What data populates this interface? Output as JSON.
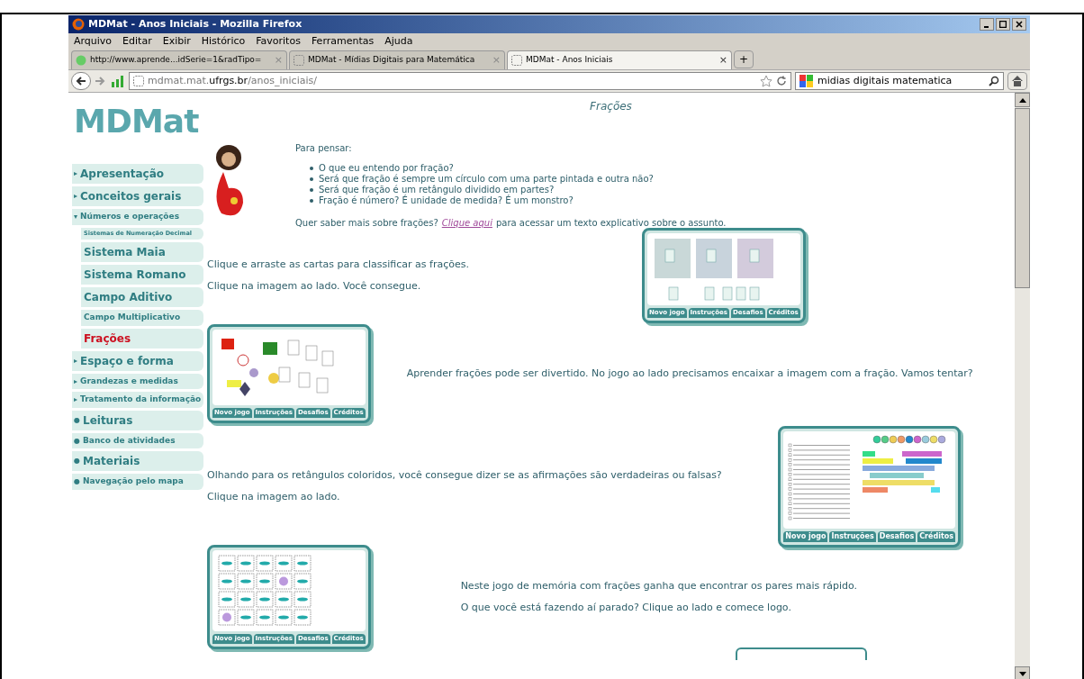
{
  "window": {
    "title": "MDMat - Anos Iniciais - Mozilla Firefox"
  },
  "menu": [
    "Arquivo",
    "Editar",
    "Exibir",
    "Histórico",
    "Favoritos",
    "Ferramentas",
    "Ajuda"
  ],
  "tabs": [
    {
      "label": "http://www.aprende...idSerie=1&radTipo=",
      "close": "×",
      "selected": false,
      "kind": "web"
    },
    {
      "label": "MDMat - Mídias Digitais para Matemática",
      "close": "×",
      "selected": false,
      "kind": "page"
    },
    {
      "label": "MDMat - Anos Iniciais",
      "close": "×",
      "selected": true,
      "kind": "page"
    }
  ],
  "new_tab": "+",
  "address": {
    "url": "mdmat.mat.**ufrgs.br**/anos_iniciais/"
  },
  "search": {
    "value": "midias digitais matematica"
  },
  "sidebar": {
    "logo": "MDMat",
    "items": [
      {
        "label": "Apresentação",
        "kind": "heading",
        "marker": "▸",
        "selected": false
      },
      {
        "label": "Conceitos gerais",
        "kind": "heading",
        "marker": "▸",
        "selected": false
      },
      {
        "label": "Números e operações",
        "kind": "minor",
        "marker": "▾",
        "selected": false,
        "children": [
          {
            "label": "Sistemas de Numeração Decimal",
            "kind": "tiny",
            "selected": false
          },
          {
            "label": "Sistema Maia",
            "kind": "heading",
            "selected": false
          },
          {
            "label": "Sistema Romano",
            "kind": "heading",
            "selected": false
          },
          {
            "label": "Campo Aditivo",
            "kind": "heading",
            "selected": false
          },
          {
            "label": "Campo Multiplicativo",
            "kind": "minor",
            "selected": false
          },
          {
            "label": "Frações",
            "kind": "heading",
            "selected": true
          }
        ]
      },
      {
        "label": "Espaço e forma",
        "kind": "heading",
        "marker": "▸",
        "selected": false
      },
      {
        "label": "Grandezas e medidas",
        "kind": "minor",
        "marker": "▸",
        "selected": false
      },
      {
        "label": "Tratamento da informação",
        "kind": "minor",
        "marker": "▸",
        "selected": false
      },
      {
        "label": "Leituras",
        "kind": "heading",
        "marker": "●",
        "selected": false
      },
      {
        "label": "Banco de atividades",
        "kind": "minor",
        "marker": "●",
        "selected": false
      },
      {
        "label": "Materiais",
        "kind": "heading",
        "marker": "●",
        "selected": false
      },
      {
        "label": "Navegação pelo mapa",
        "kind": "minor",
        "marker": "●",
        "selected": false
      }
    ]
  },
  "page": {
    "title": "Frações",
    "think": {
      "heading": "Para pensar:",
      "questions": [
        "O que eu entendo por fração?",
        "Será que fração é sempre um círculo com uma parte pintada e outra não?",
        "Será que fração é um retângulo dividido em partes?",
        "Fração é número? É unidade de medida? É um monstro?"
      ],
      "more_before": "Quer saber mais sobre frações?",
      "more_link": "Clique aqui",
      "more_after": "para acessar um texto explicativo sobre o assunto."
    },
    "games": [
      {
        "kind": "sort",
        "texts": [
          "Clique e arraste as cartas para classificar as frações.",
          "Clique na imagem ao lado. Você consegue."
        ],
        "buttons": [
          "Novo jogo",
          "Instruções",
          "Desafios",
          "Créditos"
        ]
      },
      {
        "kind": "match",
        "texts": [
          "Aprender frações pode ser divertido. No jogo ao lado precisamos encaixar a imagem com a fração. Vamos tentar?"
        ],
        "buttons": [
          "Novo jogo",
          "Instruções",
          "Desafios",
          "Créditos"
        ]
      },
      {
        "kind": "bars",
        "texts": [
          "Olhando para os retângulos coloridos, você consegue dizer se as afirmações são verdadeiras ou falsas?",
          "Clique na imagem ao lado."
        ],
        "buttons": [
          "Novo jogo",
          "Instruções",
          "Desafios",
          "Créditos"
        ]
      },
      {
        "kind": "memory",
        "texts": [
          "Neste jogo de memória com frações ganha que encontrar os pares mais rápido.",
          "O que você está fazendo aí parado? Clique ao lado e comece logo."
        ],
        "buttons": [
          "Novo jogo",
          "Instruções",
          "Desafios",
          "Créditos"
        ]
      }
    ]
  }
}
